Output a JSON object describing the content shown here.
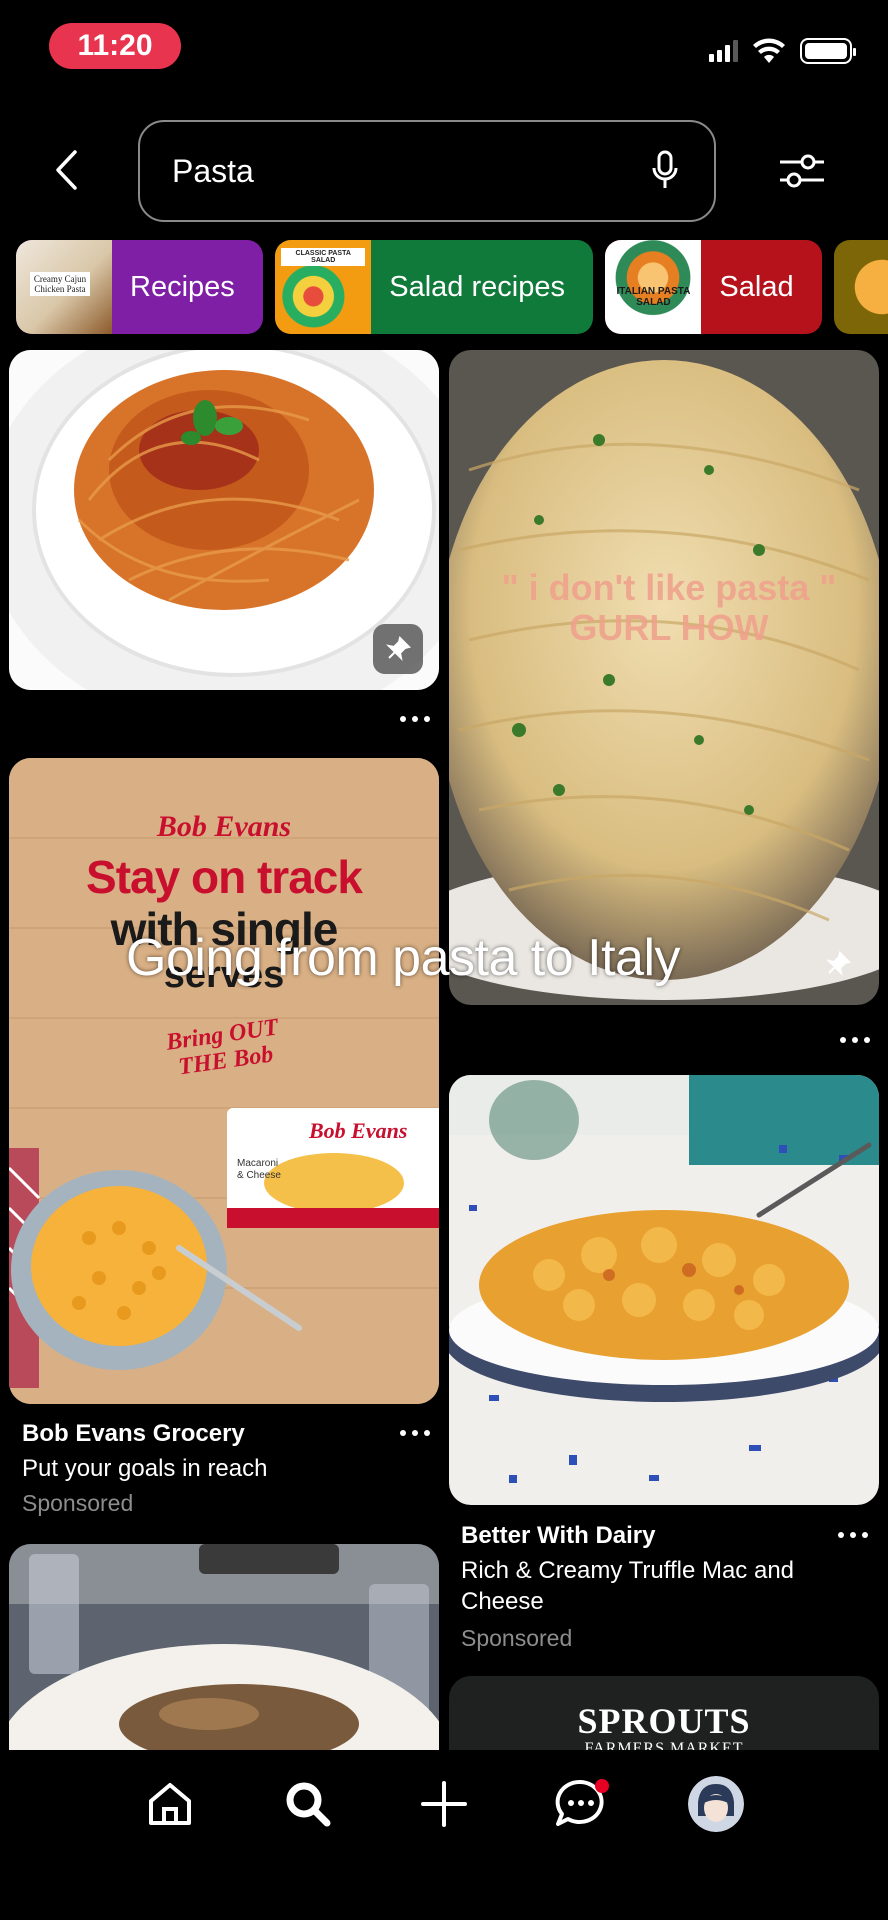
{
  "status_bar": {
    "time": "11:20"
  },
  "search": {
    "query": "Pasta"
  },
  "chips": [
    {
      "thumb_text": "Creamy Cajun Chicken Pasta",
      "label": "Recipes",
      "color": "#7e1fa6"
    },
    {
      "thumb_text": "CLASSIC PASTA SALAD",
      "label": "Salad recipes",
      "color": "#0f7a3a"
    },
    {
      "thumb_text": "ITALIAN PASTA SALAD",
      "label": "Salad",
      "color": "#b5121b"
    }
  ],
  "pins": {
    "pin2_overlay": "\" i don't like pasta \" GURL HOW",
    "bob_evans": {
      "brand": "Bob Evans",
      "headline_1": "Stay on track",
      "headline_2": "with single",
      "headline_3": "serves",
      "tagline": "Bring OUT THE Bob",
      "product_brand": "Bob Evans",
      "product_name": "Macaroni & Cheese",
      "title": "Bob Evans Grocery",
      "description": "Put your goals in reach",
      "sponsored": "Sponsored"
    },
    "dairy": {
      "title": "Better With Dairy",
      "description": "Rich & Creamy Truffle Mac and Cheese",
      "sponsored": "Sponsored"
    },
    "sprouts": {
      "brand": "SPROUTS",
      "sub": "FARMERS MARKET"
    }
  },
  "video_caption": "Going from pasta to Italy",
  "nav": {
    "notification_color": "#e60023"
  }
}
